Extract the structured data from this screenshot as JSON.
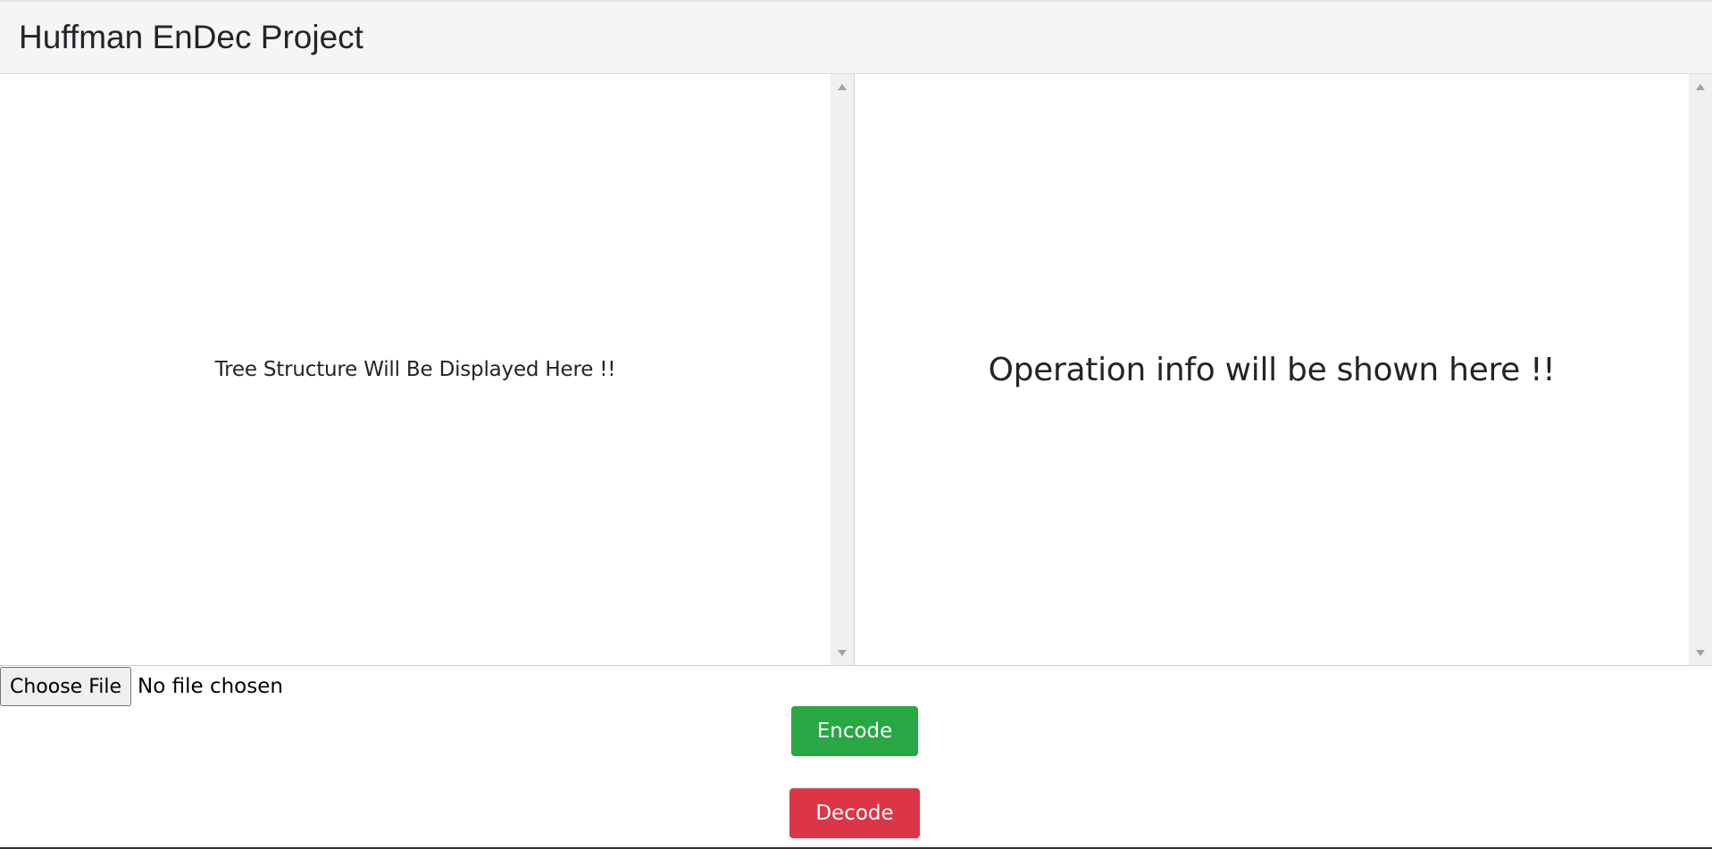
{
  "header": {
    "title": "Huffman EnDec Project"
  },
  "tree_panel": {
    "placeholder": "Tree Structure Will Be Displayed Here !!"
  },
  "info_panel": {
    "placeholder": "Operation info will be shown here !!"
  },
  "file_input": {
    "button_label": "Choose File",
    "status": "No file chosen"
  },
  "actions": {
    "encode_label": "Encode",
    "decode_label": "Decode"
  },
  "colors": {
    "encode": "#28a745",
    "decode": "#dc3545",
    "header_bg": "#f5f5f5"
  },
  "icons": {
    "scroll_up": "triangle-up-icon",
    "scroll_down": "triangle-down-icon"
  }
}
